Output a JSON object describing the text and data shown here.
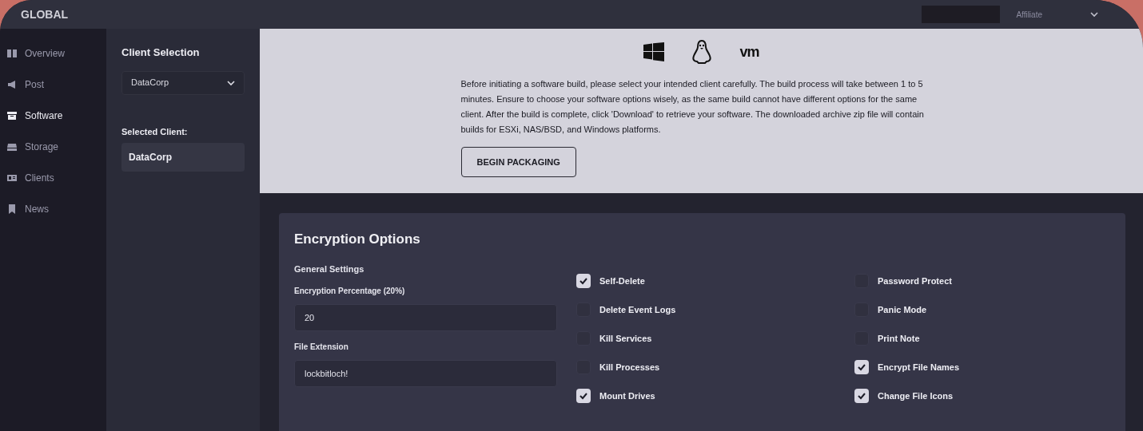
{
  "header": {
    "title": "GLOBAL",
    "account": "Affiliate"
  },
  "sidebar": {
    "items": [
      {
        "label": "Overview",
        "selected": false
      },
      {
        "label": "Post",
        "selected": false
      },
      {
        "label": "Software",
        "selected": true
      },
      {
        "label": "Storage",
        "selected": false
      },
      {
        "label": "Clients",
        "selected": false
      },
      {
        "label": "News",
        "selected": false
      }
    ]
  },
  "client_panel": {
    "title": "Client Selection",
    "dropdown": "DataCorp",
    "selected_label": "Selected Client:",
    "selected_value": "DataCorp"
  },
  "build": {
    "vm_label": "vm",
    "description": "Before initiating a software build, please select your intended client carefully. The build process will take between 1 to 5 minutes. Ensure to choose your software options wisely, as the same build cannot have different options for the same client. After the build is complete, click 'Download' to retrieve your software. The downloaded archive zip file will contain builds for ESXi, NAS/BSD, and Windows platforms.",
    "button": "BEGIN PACKAGING"
  },
  "options": {
    "title": "Encryption Options",
    "subtitle": "General Settings",
    "fields": [
      {
        "label": "Encryption Percentage (20%)",
        "value": "20"
      },
      {
        "label": "File Extension",
        "value": "lockbitloch!"
      }
    ],
    "columns": [
      [
        {
          "label": "Self-Delete",
          "checked": true
        },
        {
          "label": "Delete Event Logs",
          "checked": false
        },
        {
          "label": "Kill Services",
          "checked": false
        },
        {
          "label": "Kill Processes",
          "checked": false
        },
        {
          "label": "Mount Drives",
          "checked": true
        }
      ],
      [
        {
          "label": "Password Protect",
          "checked": false
        },
        {
          "label": "Panic Mode",
          "checked": false
        },
        {
          "label": "Print Note",
          "checked": false
        },
        {
          "label": "Encrypt File Names",
          "checked": true
        },
        {
          "label": "Change File Icons",
          "checked": true
        }
      ]
    ]
  }
}
